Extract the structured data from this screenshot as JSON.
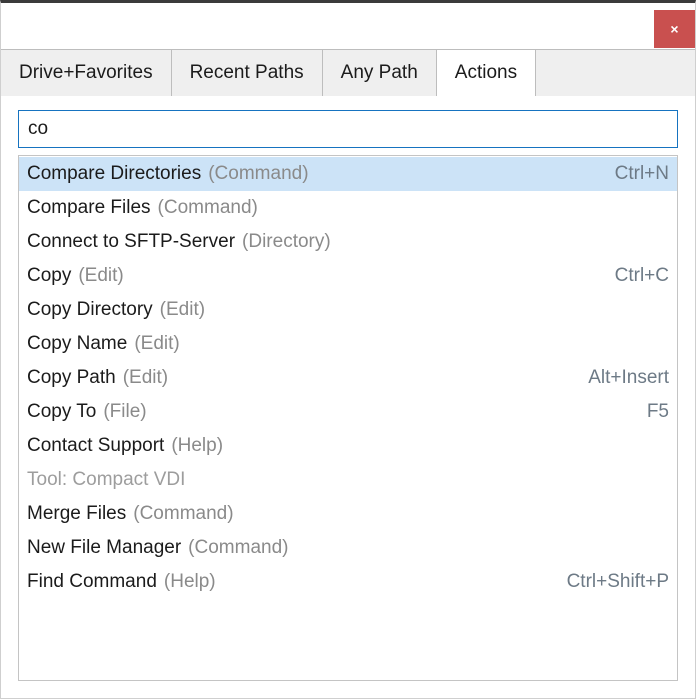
{
  "window": {
    "close_label": "×"
  },
  "tabs": [
    {
      "label": "Drive+Favorites",
      "active": false
    },
    {
      "label": "Recent Paths",
      "active": false
    },
    {
      "label": "Any Path",
      "active": false
    },
    {
      "label": "Actions",
      "active": true
    }
  ],
  "search": {
    "value": "co",
    "placeholder": ""
  },
  "results": [
    {
      "label": "Compare Directories",
      "category": "(Command)",
      "shortcut": "Ctrl+N",
      "selected": true,
      "disabled": false
    },
    {
      "label": "Compare Files",
      "category": "(Command)",
      "shortcut": "",
      "selected": false,
      "disabled": false
    },
    {
      "label": "Connect to SFTP-Server",
      "category": "(Directory)",
      "shortcut": "",
      "selected": false,
      "disabled": false
    },
    {
      "label": "Copy",
      "category": "(Edit)",
      "shortcut": "Ctrl+C",
      "selected": false,
      "disabled": false
    },
    {
      "label": "Copy Directory",
      "category": "(Edit)",
      "shortcut": "",
      "selected": false,
      "disabled": false
    },
    {
      "label": "Copy Name",
      "category": "(Edit)",
      "shortcut": "",
      "selected": false,
      "disabled": false
    },
    {
      "label": "Copy Path",
      "category": "(Edit)",
      "shortcut": "Alt+Insert",
      "selected": false,
      "disabled": false
    },
    {
      "label": "Copy To",
      "category": "(File)",
      "shortcut": "F5",
      "selected": false,
      "disabled": false
    },
    {
      "label": "Contact Support",
      "category": "(Help)",
      "shortcut": "",
      "selected": false,
      "disabled": false
    },
    {
      "label": "Tool: Compact VDI",
      "category": "",
      "shortcut": "",
      "selected": false,
      "disabled": true
    },
    {
      "label": "Merge Files",
      "category": "(Command)",
      "shortcut": "",
      "selected": false,
      "disabled": false
    },
    {
      "label": "New File Manager",
      "category": "(Command)",
      "shortcut": "",
      "selected": false,
      "disabled": false
    },
    {
      "label": "Find Command",
      "category": "(Help)",
      "shortcut": "Ctrl+Shift+P",
      "selected": false,
      "disabled": false
    }
  ],
  "colors": {
    "accent_border": "#1673c0",
    "selection": "#cce3f7",
    "close_button": "#c9504f",
    "tabstrip": "#efefef",
    "category_text": "#8a8a8a",
    "shortcut_text": "#6d7a86",
    "disabled_text": "#9d9d9d"
  }
}
